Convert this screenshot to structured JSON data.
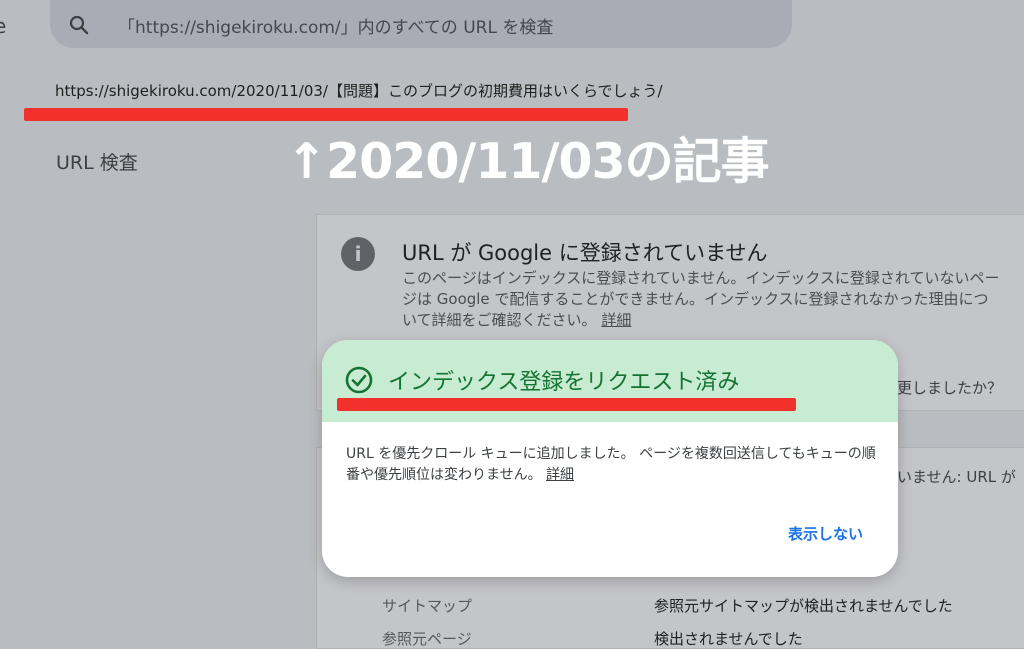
{
  "header": {
    "brand_fragment": "e",
    "search_text": "「https://shigekiroku.com/」内のすべての URL を検査",
    "search_icon": "search-icon"
  },
  "inspected_url": "https://shigekiroku.com/2020/11/03/【問題】このブログの初期費用はいくらでしょう/",
  "sidebar": {
    "title": "URL 検査"
  },
  "annotation": {
    "text": "↑2020/11/03の記事"
  },
  "status_card": {
    "icon": "info-icon",
    "icon_glyph": "i",
    "title": "URL が Google に登録されていません",
    "description": "このページはインデックスに登録されていません。インデックスに登録されていないページは Google で配信することができません。インデックスに登録されなかった理由について詳細をご確認ください。",
    "link": "詳細",
    "tail_text": "更しましたか？"
  },
  "coverage_card": {
    "tail_text": "いません: URL が",
    "rows": [
      {
        "label": "サイトマップ",
        "value": "参照元サイトマップが検出されませんでした"
      },
      {
        "label": "参照元ページ",
        "value": "検出されませんでした"
      }
    ]
  },
  "dialog": {
    "icon": "check-circle-icon",
    "title": "インデックス登録をリクエスト済み",
    "body": "URL を優先クロール キューに追加しました。 ページを複数回送信してもキューの順番や優先順位は変わりません。",
    "link": "詳細",
    "dismiss_label": "表示しない"
  },
  "colors": {
    "annotation_underline": "#f2302c",
    "dialog_header": "#c8ecd1",
    "success_text": "#137333",
    "link_blue": "#1a73e8"
  }
}
